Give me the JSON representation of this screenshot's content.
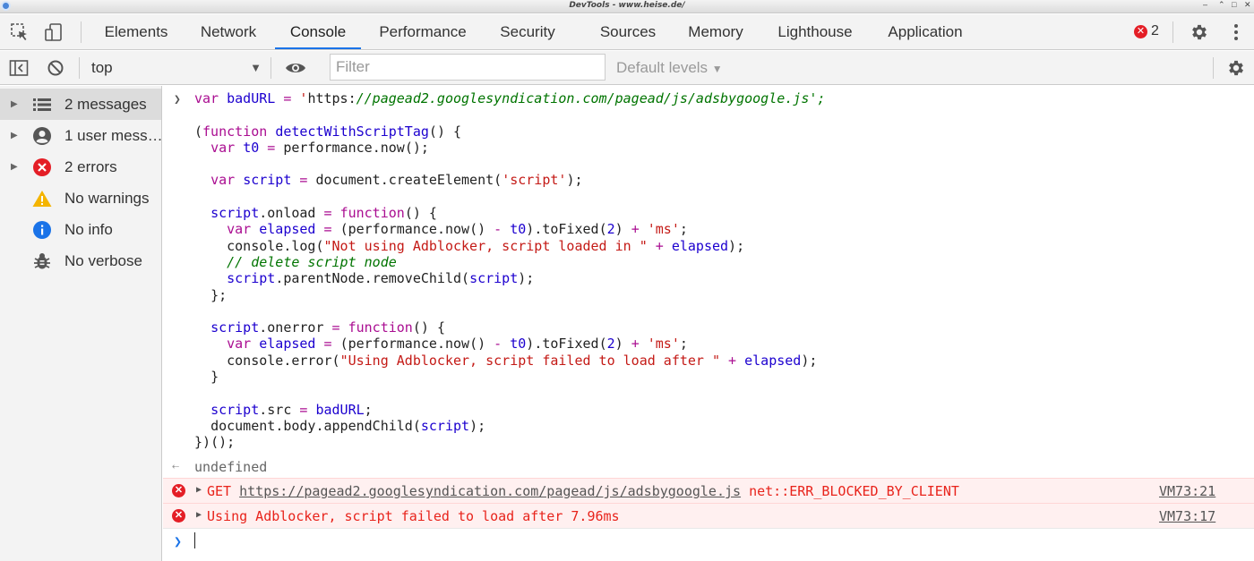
{
  "window": {
    "title": "DevTools - www.heise.de/"
  },
  "tabs": [
    {
      "label": "Elements"
    },
    {
      "label": "Network"
    },
    {
      "label": "Console"
    },
    {
      "label": "Performance"
    },
    {
      "label": "Security"
    },
    {
      "label": "Sources"
    },
    {
      "label": "Memory"
    },
    {
      "label": "Lighthouse"
    },
    {
      "label": "Application"
    }
  ],
  "active_tab": "Console",
  "error_count": "2",
  "console_toolbar": {
    "context": "top",
    "filter_placeholder": "Filter",
    "levels": "Default levels"
  },
  "sidebar": {
    "items": [
      {
        "label": "2 messages",
        "icon": "list-icon"
      },
      {
        "label": "1 user mess…",
        "icon": "user-icon"
      },
      {
        "label": "2 errors",
        "icon": "error-icon"
      },
      {
        "label": "No warnings",
        "icon": "warning-icon"
      },
      {
        "label": "No info",
        "icon": "info-icon"
      },
      {
        "label": "No verbose",
        "icon": "bug-icon"
      }
    ]
  },
  "console": {
    "code_lines": [
      "var badURL = 'https://pagead2.googlesyndication.com/pagead/js/adsbygoogle.js';",
      "",
      "(function detectWithScriptTag() {",
      "  var t0 = performance.now();",
      "",
      "  var script = document.createElement('script');",
      "",
      "  script.onload = function() {",
      "    var elapsed = (performance.now() - t0).toFixed(2) + 'ms';",
      "    console.log(\"Not using Adblocker, script loaded in \" + elapsed);",
      "    // delete script node",
      "    script.parentNode.removeChild(script);",
      "  };",
      "",
      "  script.onerror = function() {",
      "    var elapsed = (performance.now() - t0).toFixed(2) + 'ms';",
      "    console.error(\"Using Adblocker, script failed to load after \" + elapsed);",
      "  }",
      "",
      "  script.src = badURL;",
      "  document.body.appendChild(script);",
      "})();"
    ],
    "result": "undefined",
    "errors": [
      {
        "method": "GET",
        "url": "https://pagead2.googlesyndication.com/pagead/js/adsbygoogle.js",
        "detail": "net::ERR_BLOCKED_BY_CLIENT",
        "source": "VM73:21"
      },
      {
        "method": "",
        "url": "",
        "detail": "Using Adblocker, script failed to load after 7.96ms",
        "source": "VM73:17"
      }
    ]
  },
  "colors": {
    "error": "#e8231b",
    "error_bg": "#fff0f0",
    "accent": "#1a73e8"
  }
}
